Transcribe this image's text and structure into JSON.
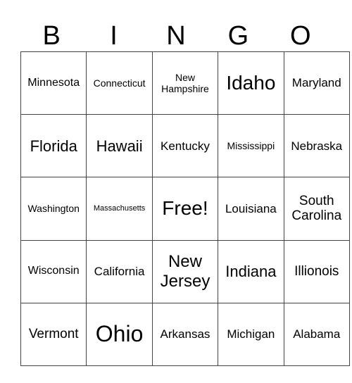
{
  "header": [
    "B",
    "I",
    "N",
    "G",
    "O"
  ],
  "rows": [
    [
      "Minnesota",
      "Connecticut",
      "New Hampshire",
      "Idaho",
      "Maryland"
    ],
    [
      "Florida",
      "Hawaii",
      "Kentucky",
      "Mississippi",
      "Nebraska"
    ],
    [
      "Washington",
      "Massachusetts",
      "Free!",
      "Louisiana",
      "South Carolina"
    ],
    [
      "Wisconsin",
      "California",
      "New Jersey",
      "Indiana",
      "Illionois"
    ],
    [
      "Vermont",
      "Ohio",
      "Arkansas",
      "Michigan",
      "Alabama"
    ]
  ]
}
